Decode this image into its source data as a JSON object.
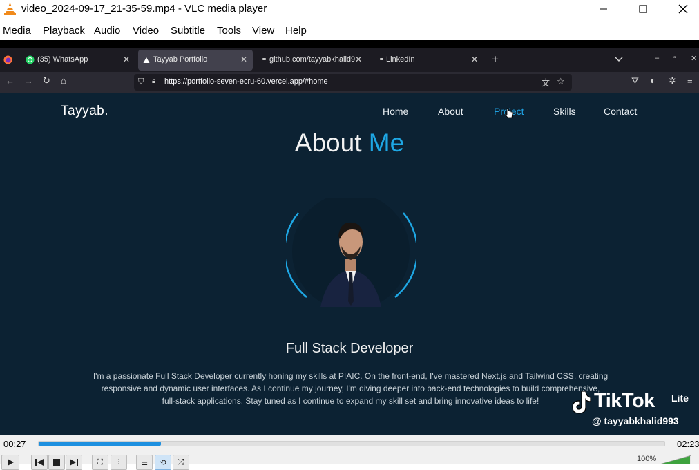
{
  "window": {
    "title": "video_2024-09-17_21-35-59.mp4 - VLC media player",
    "controls": [
      "minimize",
      "maximize",
      "close"
    ]
  },
  "menu": {
    "items": [
      "Media",
      "Playback",
      "Audio",
      "Video",
      "Subtitle",
      "Tools",
      "View",
      "Help"
    ]
  },
  "browser": {
    "tabs": [
      {
        "label": "(35) WhatsApp",
        "icon": "whatsapp-icon"
      },
      {
        "label": "Tayyab Portfolio",
        "icon": "vercel-icon"
      },
      {
        "label": "github.com/tayyabkhalid9",
        "icon": "dot-icon"
      },
      {
        "label": "LinkedIn",
        "icon": "dot-icon"
      }
    ],
    "url": "https://portfolio-seven-ecru-60.vercel.app/#home"
  },
  "site": {
    "brand": "Tayyab.",
    "nav": [
      "Home",
      "About",
      "Project",
      "Skills",
      "Contact"
    ],
    "active_nav": "Project",
    "heading_plain": "About ",
    "heading_accent": "Me",
    "role": "Full Stack Developer",
    "bio_lines": [
      "I'm a passionate Full Stack Developer currently honing my skills at PIAIC. On the front-end, I've mastered Next.js and Tailwind CSS, creating",
      "responsive and dynamic user interfaces. As I continue my journey, I'm diving deeper into back-end technologies to build comprehensive,",
      "full-stack applications. Stay tuned as I continue to expand my skill set and bring innovative ideas to life!"
    ],
    "colors": {
      "background": "#0c2233",
      "accent": "#1ea7e4"
    }
  },
  "overlay": {
    "brand": "TikTok",
    "brand_suffix": "Lite",
    "handle": "@ tayyabkhalid993"
  },
  "player": {
    "elapsed": "00:27",
    "total": "02:23",
    "progress": 0.195,
    "volume": "100%"
  }
}
